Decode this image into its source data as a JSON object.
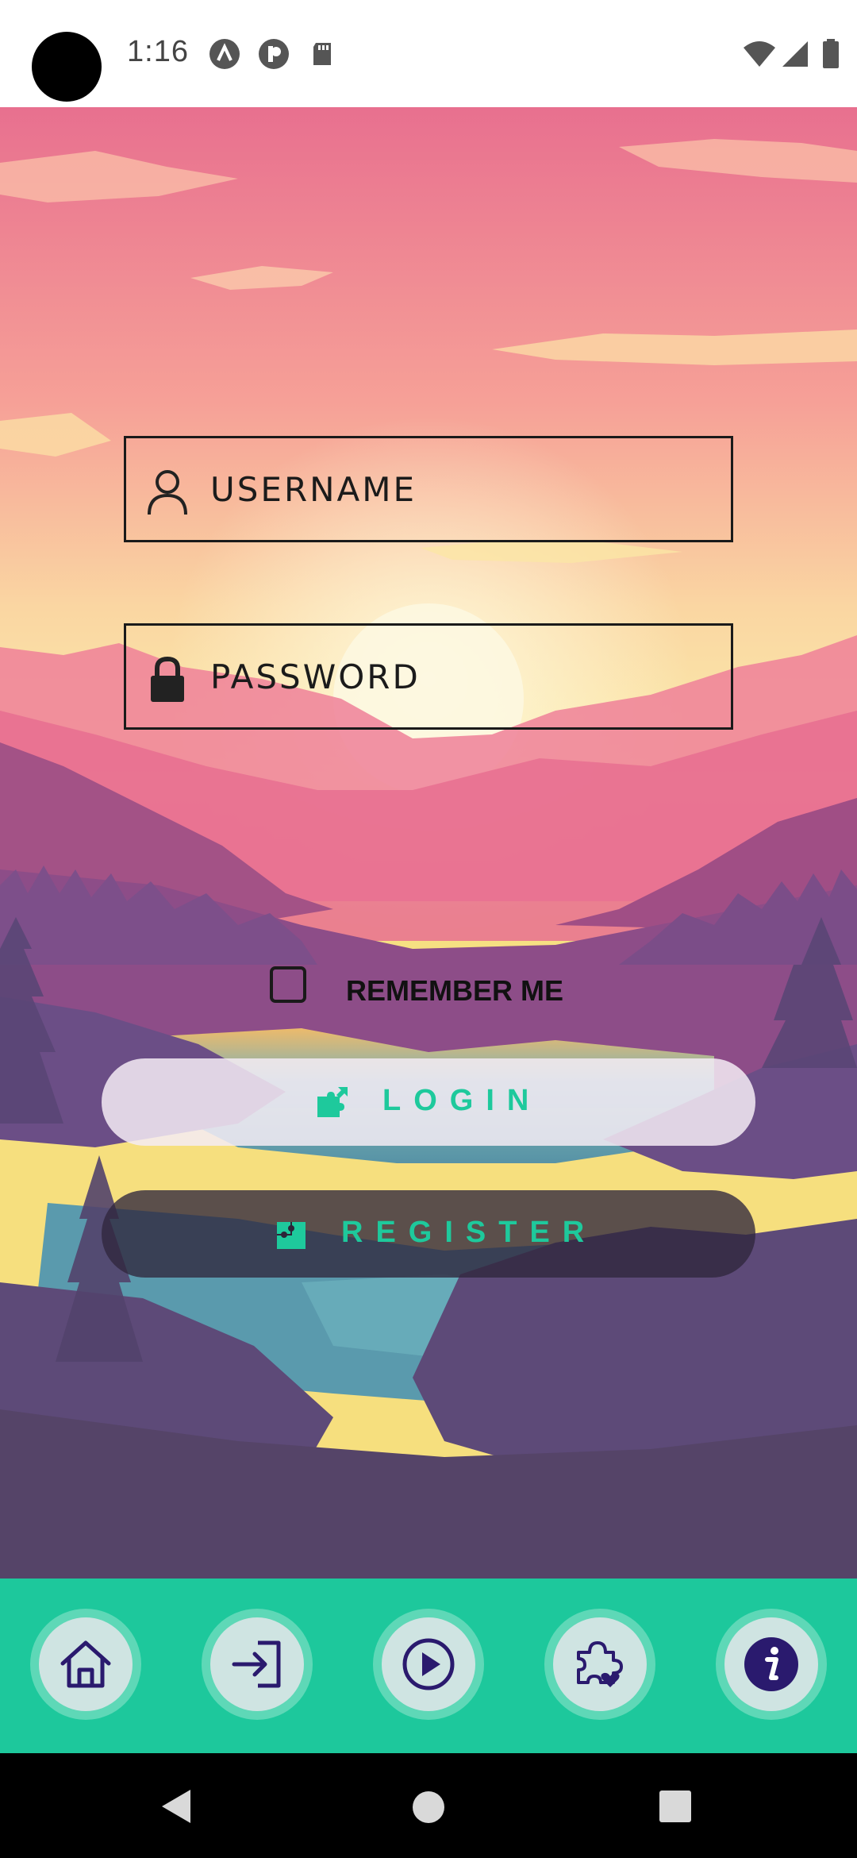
{
  "status": {
    "time": "1:16"
  },
  "form": {
    "username_placeholder": "USERNAME",
    "password_placeholder": "PASSWORD",
    "remember_label": "REMEMBER ME",
    "login_label": "LOGIN",
    "register_label": "REGISTER"
  },
  "bottom_nav": {
    "items": [
      {
        "icon": "home-icon"
      },
      {
        "icon": "login-arrow-icon"
      },
      {
        "icon": "play-icon"
      },
      {
        "icon": "puzzle-heart-icon"
      },
      {
        "icon": "info-icon"
      }
    ]
  },
  "colors": {
    "accent": "#1dc89c",
    "nav_icon": "#2a1a6e"
  }
}
